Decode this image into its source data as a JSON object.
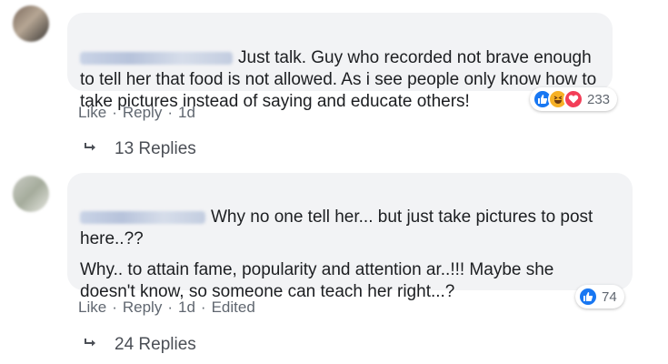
{
  "comment1": {
    "text": "Just talk. Guy who recorded not brave enough\nto tell her that food is not allowed. As i see people only know how to\ntake pictures instead of saying and educate others!",
    "actions": {
      "like": "Like",
      "reply": "Reply",
      "time": "1d"
    },
    "reactions": {
      "icons": [
        "like-icon",
        "haha-icon",
        "love-icon"
      ],
      "count": "233"
    },
    "replies_label": "13 Replies"
  },
  "comment2": {
    "para1": "Why no one tell her... but just take pictures to post\nhere..??",
    "para2": "Why.. to attain fame, popularity and attention ar..!!! Maybe she\ndoesn't know, so someone can teach her right...?",
    "actions": {
      "like": "Like",
      "reply": "Reply",
      "time": "1d",
      "edited": "Edited"
    },
    "reactions": {
      "icons": [
        "like-icon"
      ],
      "count": "74"
    },
    "replies_label": "24 Replies"
  },
  "colors": {
    "bubble": "#f2f3f5",
    "like": "#1877f2",
    "haha": "#f7b125",
    "love": "#f33e58",
    "meta": "#606770"
  }
}
